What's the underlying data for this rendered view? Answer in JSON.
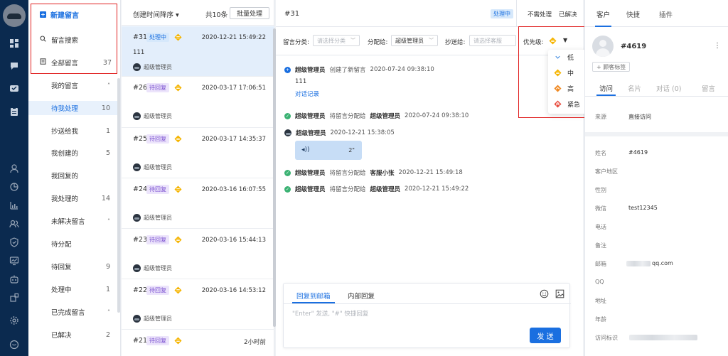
{
  "sidebar": {
    "new_label": "新建留言",
    "search_label": "留言搜索",
    "all_label": "全部留言",
    "all_count": "37",
    "items": [
      {
        "label": "我的留言",
        "count": "",
        "group": true
      },
      {
        "label": "待我处理",
        "count": "10",
        "active": true
      },
      {
        "label": "抄送给我",
        "count": "1"
      },
      {
        "label": "我创建的",
        "count": "5"
      },
      {
        "label": "我回复的",
        "count": ""
      },
      {
        "label": "我处理的",
        "count": "14"
      },
      {
        "label": "未解决留言",
        "count": "",
        "group": true
      },
      {
        "label": "待分配",
        "count": ""
      },
      {
        "label": "待回复",
        "count": "9"
      },
      {
        "label": "处理中",
        "count": "1"
      },
      {
        "label": "已完成留言",
        "count": "",
        "group": true
      },
      {
        "label": "已解决",
        "count": "2"
      }
    ]
  },
  "list": {
    "sort_label": "创建时间降序",
    "total_label": "共10条",
    "batch_label": "批量处理",
    "tickets": [
      {
        "no": "#31",
        "status": "处理中",
        "status_type": "proc",
        "time": "2020-12-21 15:49:22",
        "body": "111",
        "agent": "超级管理员"
      },
      {
        "no": "#26",
        "status": "待回复",
        "status_type": "wait",
        "time": "2020-03-17 17:06:51",
        "body": "",
        "agent": "超级管理员"
      },
      {
        "no": "#25",
        "status": "待回复",
        "status_type": "wait",
        "time": "2020-03-17 14:35:37",
        "body": "",
        "agent": "超级管理员"
      },
      {
        "no": "#24",
        "status": "待回复",
        "status_type": "wait",
        "time": "2020-03-16 16:07:55",
        "body": "",
        "agent": "超级管理员"
      },
      {
        "no": "#23",
        "status": "待回复",
        "status_type": "wait",
        "time": "2020-03-16 15:44:13",
        "body": "",
        "agent": "超级管理员"
      },
      {
        "no": "#22",
        "status": "待回复",
        "status_type": "wait",
        "time": "2020-03-16 14:53:12",
        "body": "",
        "agent": "超级管理员"
      },
      {
        "no": "#21",
        "status": "待回复",
        "status_type": "wait",
        "time": "2小时前",
        "body": "",
        "agent": ""
      }
    ]
  },
  "detail": {
    "id": "#31",
    "state": "处理中",
    "btn_no_need": "不需处理",
    "btn_solved": "已解决",
    "filters": {
      "category_label": "留言分类:",
      "category_placeholder": "请选择分类",
      "assign_label": "分配给:",
      "assign_value": "超级管理员",
      "cc_label": "抄送给:",
      "cc_placeholder": "请选择客服",
      "priority_label": "优先级:"
    },
    "events": {
      "e1": {
        "actor": "超级管理员",
        "action": "创建了新留言",
        "time": "2020-07-24 09:38:10",
        "content": "111",
        "link": "对话记录"
      },
      "e2": {
        "actor": "超级管理员",
        "action": "将留言分配给",
        "target": "超级管理员",
        "time": "2020-07-24 09:38:10"
      },
      "e3": {
        "actor": "超级管理员",
        "time": "2020-12-21 15:38:05",
        "voice_duration": "2\""
      },
      "e4": {
        "actor": "超级管理员",
        "action": "将留言分配给",
        "target": "客服小张",
        "time": "2020-12-21 15:49:18"
      },
      "e5": {
        "actor": "超级管理员",
        "action": "将留言分配给",
        "target": "超级管理员",
        "time": "2020-12-21 15:49:22"
      }
    },
    "reply": {
      "tab_email": "回复到邮箱",
      "tab_internal": "内部回复",
      "placeholder": "\"Enter\" 发送, \"#\" 快捷回复",
      "send_label": "发 送"
    }
  },
  "priority_menu": {
    "options": [
      {
        "label": "低",
        "color": "#4a90e2"
      },
      {
        "label": "中",
        "color": "#f5b400"
      },
      {
        "label": "高",
        "color": "#f08a24"
      },
      {
        "label": "紧急",
        "color": "#e84a3c"
      }
    ]
  },
  "customer": {
    "tabs": [
      "客户",
      "快捷",
      "插件"
    ],
    "name": "#4619",
    "more": "⋮",
    "tag_button": "+ 顾客标签",
    "subtabs": [
      "访问",
      "名片",
      "对话 (0)",
      "留言"
    ],
    "source_label": "来源",
    "source_value": "直接访问",
    "fields": [
      {
        "k": "姓名",
        "v": "#4619"
      },
      {
        "k": "客户地区",
        "v": ""
      },
      {
        "k": "性别",
        "v": ""
      },
      {
        "k": "微信",
        "v": "test12345"
      },
      {
        "k": "电话",
        "v": ""
      },
      {
        "k": "备注",
        "v": ""
      },
      {
        "k": "邮箱",
        "v": "qq.com"
      },
      {
        "k": "QQ",
        "v": ""
      },
      {
        "k": "地址",
        "v": ""
      },
      {
        "k": "年龄",
        "v": ""
      },
      {
        "k": "访问标识",
        "v": ""
      }
    ]
  },
  "colors": {
    "accent": "#1a6fe0",
    "rail": "#0b2a4f",
    "highlight": "#e02020"
  }
}
